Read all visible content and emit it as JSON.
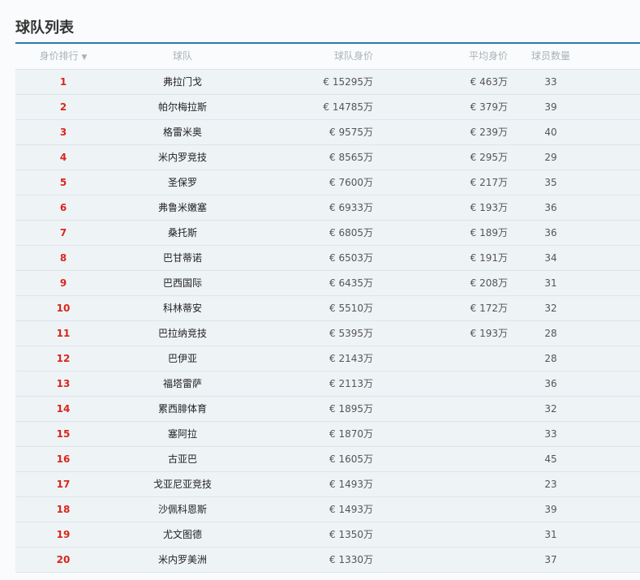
{
  "title": "球队列表",
  "columns": {
    "rank": "身价排行",
    "team": "球队",
    "value": "球队身价",
    "avg": "平均身价",
    "count": "球员数量"
  },
  "rows": [
    {
      "rank": "1",
      "team": "弗拉门戈",
      "value": "€ 15295万",
      "avg": "€ 463万",
      "count": "33"
    },
    {
      "rank": "2",
      "team": "帕尔梅拉斯",
      "value": "€ 14785万",
      "avg": "€ 379万",
      "count": "39"
    },
    {
      "rank": "3",
      "team": "格雷米奥",
      "value": "€ 9575万",
      "avg": "€ 239万",
      "count": "40"
    },
    {
      "rank": "4",
      "team": "米内罗竞技",
      "value": "€ 8565万",
      "avg": "€ 295万",
      "count": "29"
    },
    {
      "rank": "5",
      "team": "圣保罗",
      "value": "€ 7600万",
      "avg": "€ 217万",
      "count": "35"
    },
    {
      "rank": "6",
      "team": "弗鲁米嫩塞",
      "value": "€ 6933万",
      "avg": "€ 193万",
      "count": "36"
    },
    {
      "rank": "7",
      "team": "桑托斯",
      "value": "€ 6805万",
      "avg": "€ 189万",
      "count": "36"
    },
    {
      "rank": "8",
      "team": "巴甘蒂诺",
      "value": "€ 6503万",
      "avg": "€ 191万",
      "count": "34"
    },
    {
      "rank": "9",
      "team": "巴西国际",
      "value": "€ 6435万",
      "avg": "€ 208万",
      "count": "31"
    },
    {
      "rank": "10",
      "team": "科林蒂安",
      "value": "€ 5510万",
      "avg": "€ 172万",
      "count": "32"
    },
    {
      "rank": "11",
      "team": "巴拉纳竞技",
      "value": "€ 5395万",
      "avg": "€ 193万",
      "count": "28"
    },
    {
      "rank": "12",
      "team": "巴伊亚",
      "value": "€ 2143万",
      "avg": "",
      "count": "28"
    },
    {
      "rank": "13",
      "team": "福塔雷萨",
      "value": "€ 2113万",
      "avg": "",
      "count": "36"
    },
    {
      "rank": "14",
      "team": "累西腓体育",
      "value": "€ 1895万",
      "avg": "",
      "count": "32"
    },
    {
      "rank": "15",
      "team": "塞阿拉",
      "value": "€ 1870万",
      "avg": "",
      "count": "33"
    },
    {
      "rank": "16",
      "team": "古亚巴",
      "value": "€ 1605万",
      "avg": "",
      "count": "45"
    },
    {
      "rank": "17",
      "team": "戈亚尼亚竞技",
      "value": "€ 1493万",
      "avg": "",
      "count": "23"
    },
    {
      "rank": "18",
      "team": "沙佩科恩斯",
      "value": "€ 1493万",
      "avg": "",
      "count": "39"
    },
    {
      "rank": "19",
      "team": "尤文图德",
      "value": "€ 1350万",
      "avg": "",
      "count": "31"
    },
    {
      "rank": "20",
      "team": "米内罗美洲",
      "value": "€ 1330万",
      "avg": "",
      "count": "37"
    }
  ]
}
